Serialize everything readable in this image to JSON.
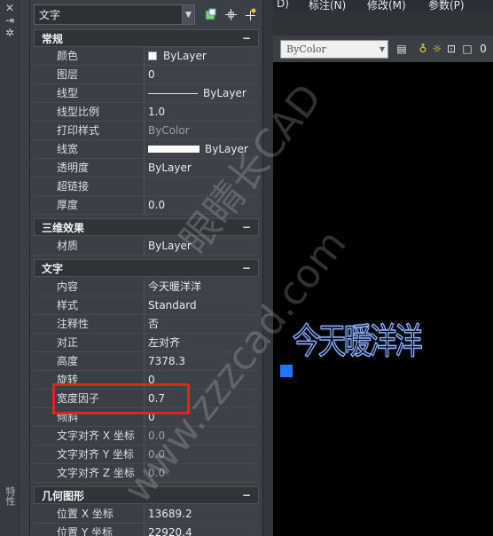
{
  "left_strip": {
    "vertical_label": "特性"
  },
  "panel": {
    "object_type": "文字",
    "sections": {
      "general": {
        "title": "常规",
        "toggle": "−",
        "rows": [
          {
            "label": "颜色",
            "value": "ByLayer"
          },
          {
            "label": "图层",
            "value": "0"
          },
          {
            "label": "线型",
            "value": "ByLayer"
          },
          {
            "label": "线型比例",
            "value": "1.0"
          },
          {
            "label": "打印样式",
            "value": "ByColor"
          },
          {
            "label": "线宽",
            "value": "ByLayer"
          },
          {
            "label": "透明度",
            "value": "ByLayer"
          },
          {
            "label": "超链接",
            "value": ""
          },
          {
            "label": "厚度",
            "value": "0.0"
          }
        ]
      },
      "three_d": {
        "title": "三维效果",
        "toggle": "−",
        "rows": [
          {
            "label": "材质",
            "value": "ByLayer"
          }
        ]
      },
      "text": {
        "title": "文字",
        "toggle": "−",
        "rows": [
          {
            "label": "内容",
            "value": "今天暖洋洋"
          },
          {
            "label": "样式",
            "value": "Standard"
          },
          {
            "label": "注释性",
            "value": "否"
          },
          {
            "label": "对正",
            "value": "左对齐"
          },
          {
            "label": "高度",
            "value": "7378.3"
          },
          {
            "label": "旋转",
            "value": "0"
          },
          {
            "label": "宽度因子",
            "value": "0.7"
          },
          {
            "label": "倾斜",
            "value": "0"
          },
          {
            "label": "文字对齐 X 坐标",
            "value": "0.0"
          },
          {
            "label": "文字对齐 Y 坐标",
            "value": "0.0"
          },
          {
            "label": "文字对齐 Z 坐标",
            "value": "0.0"
          }
        ]
      },
      "geometry": {
        "title": "几何图形",
        "toggle": "−",
        "rows": [
          {
            "label": "位置 X 坐标",
            "value": "13689.2"
          },
          {
            "label": "位置 Y 坐标",
            "value": "22920.4"
          }
        ]
      }
    }
  },
  "menubar": {
    "item1": "D)",
    "item2": "标注(N)",
    "item3": "修改(M)",
    "item4": "参数(P)"
  },
  "toolbar": {
    "plot_style_value": "ByColor"
  },
  "canvas": {
    "text": "今天暖洋洋"
  },
  "watermark": {
    "line1": "眼睛长CAD",
    "line2": "www.zzzcad.com"
  },
  "colors": {
    "highlight": "#e02520",
    "grip": "#1e78ff",
    "text_outline": "#8fb4ff"
  },
  "icons": [
    "quick-select-icon",
    "pick-objects-icon",
    "toggle-pickadd-icon",
    "layer-icon",
    "lightbulb-icon",
    "sun-icon",
    "lock-icon",
    "color-square-icon"
  ]
}
